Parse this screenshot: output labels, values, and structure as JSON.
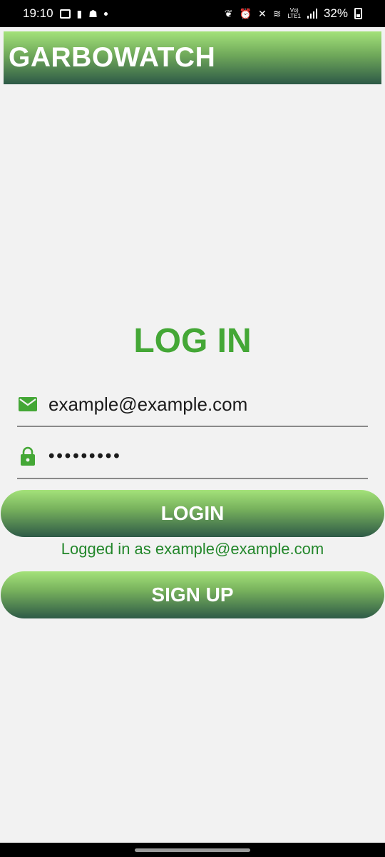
{
  "status_bar": {
    "time": "19:10",
    "battery": "32%",
    "lte": "LTE1"
  },
  "app_bar": {
    "title": "GARBOWATCH"
  },
  "login": {
    "heading": "LOG IN",
    "email_value": "example@example.com",
    "password_value": "•••••••••",
    "login_button": "LOGIN",
    "status_message": "Logged in as example@example.com",
    "signup_button": "SIGN UP"
  },
  "colors": {
    "accent_green": "#44a736",
    "message_green": "#23872b",
    "gradient_top": "#a4e27a",
    "gradient_bottom": "#2e5a47"
  },
  "icons": {
    "email": "mail-icon",
    "password": "lock-icon"
  }
}
